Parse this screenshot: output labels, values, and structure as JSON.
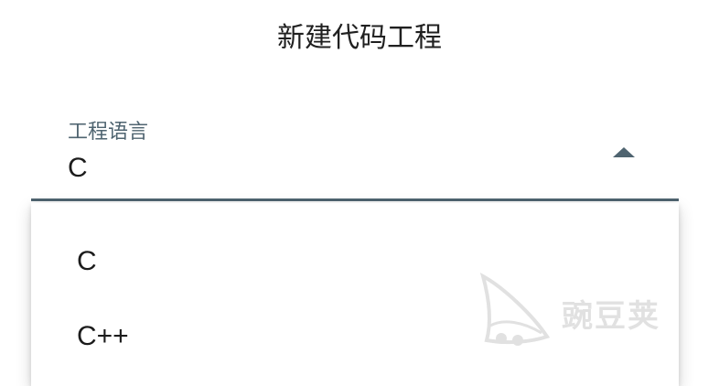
{
  "dialog": {
    "title": "新建代码工程"
  },
  "language_field": {
    "label": "工程语言",
    "value": "C",
    "icon": "arrow-up-icon"
  },
  "menu": {
    "items": [
      {
        "label": "C"
      },
      {
        "label": "C++"
      }
    ]
  },
  "watermark": {
    "text": "豌豆荚"
  },
  "colors": {
    "accent": "#4f6470",
    "text": "#1c1c1c",
    "background": "#ffffff"
  }
}
